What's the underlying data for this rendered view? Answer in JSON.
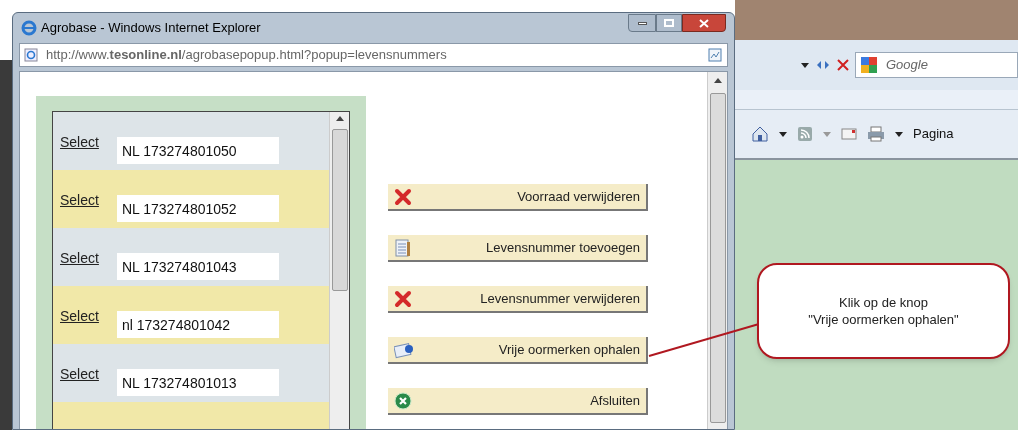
{
  "popup": {
    "title": "Agrobase - Windows Internet Explorer",
    "address": "http://www.**tesonline.nl**/agrobasepopup.html?popup=levensnummers"
  },
  "list": {
    "rows": [
      {
        "link": "Select",
        "value": "NL 173274801050"
      },
      {
        "link": "Select",
        "value": "NL 173274801052"
      },
      {
        "link": "Select",
        "value": "NL 173274801043"
      },
      {
        "link": "Select",
        "value": "nl 173274801042"
      },
      {
        "link": "Select",
        "value": "NL 173274801013"
      }
    ]
  },
  "buttons": [
    {
      "label": "Voorraad verwijderen",
      "kind": "delete"
    },
    {
      "label": "Levensnummer toevoegen",
      "kind": "add"
    },
    {
      "label": "Levensnummer verwijderen",
      "kind": "delete"
    },
    {
      "label": "Vrije oormerken ophalen",
      "kind": "fetch"
    },
    {
      "label": "Afsluiten",
      "kind": "close"
    }
  ],
  "browser": {
    "search_placeholder": "Google",
    "command_bar": "Pagina"
  },
  "callout": {
    "lines": [
      "Klik op de knop",
      "\"Vrije oormerken ophalen\""
    ]
  }
}
